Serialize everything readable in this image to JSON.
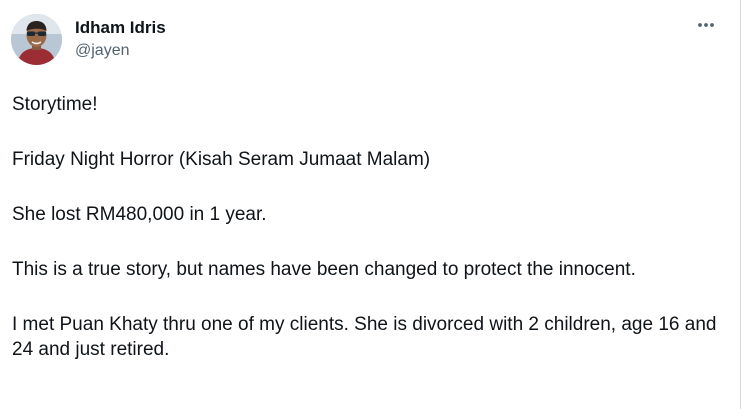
{
  "author": {
    "name": "Idham Idris",
    "handle": "@jayen",
    "avatar_icon": "profile-avatar"
  },
  "more_icon": "more-horizontal-icon",
  "tweet": {
    "paragraphs": [
      "Storytime!",
      "Friday Night Horror (Kisah Seram Jumaat Malam)",
      "She lost RM480,000 in 1 year.",
      "This is a true story, but names have been changed to protect the innocent.",
      "I met Puan Khaty thru one of my clients. She is divorced with 2 children, age 16 and 24 and just retired."
    ]
  },
  "colors": {
    "text": "#0f1419",
    "secondary_text": "#536471",
    "border": "#cfd9de"
  }
}
